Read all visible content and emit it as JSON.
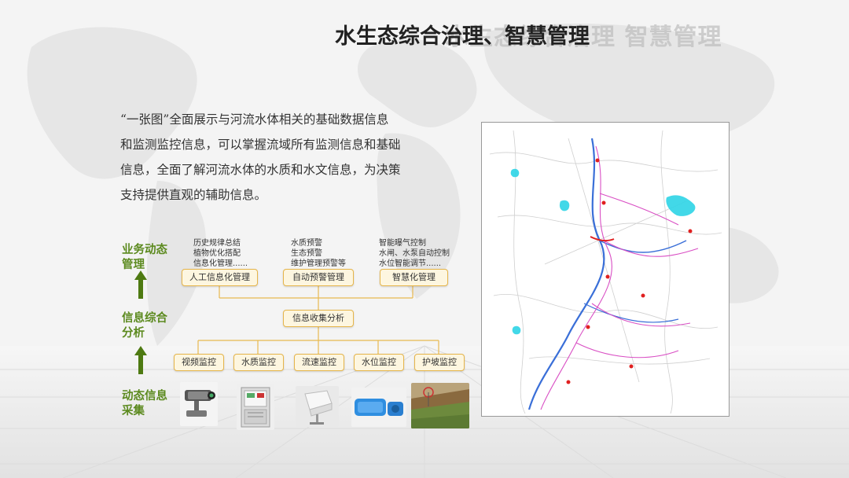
{
  "header": {
    "title": "水生态综合治理、智慧管理",
    "ghost_title": "水生态综合治理 智慧管理"
  },
  "intro": {
    "lines": [
      "“一张图”全面展示与河流水体相关的基础数据信息",
      "和监测监控信息，可以掌握流域所有监测信息和基础",
      "信息，全面了解河流水体的水质和水文信息，为决策",
      "支持提供直观的辅助信息。"
    ]
  },
  "diagram": {
    "levels": [
      {
        "line1": "业务动态",
        "line2": "管理"
      },
      {
        "line1": "信息综合",
        "line2": "分析"
      },
      {
        "line1": "动态信息",
        "line2": "采集"
      }
    ],
    "management_boxes": [
      {
        "label": "人工信息化管理",
        "notes": [
          "历史规律总结",
          "植物优化搭配",
          "信息化管理......"
        ]
      },
      {
        "label": "自动预警管理",
        "notes": [
          "水质预警",
          "生态预警",
          "维护管理预警等"
        ]
      },
      {
        "label": "智慧化管理",
        "notes": [
          "智能曝气控制",
          "水闸、水泵自动控制",
          "水位智能调节......"
        ]
      }
    ],
    "analysis_box": "信息收集分析",
    "monitor_boxes": [
      "视频监控",
      "水质监控",
      "流速监控",
      "水位监控",
      "护坡监控"
    ]
  },
  "icons": {
    "arrow": "up-arrow-icon",
    "devices": [
      "cctv-camera-icon",
      "water-quality-cabinet-icon",
      "flow-sensor-icon",
      "water-level-sensor-icon",
      "slope-photo-icon"
    ]
  },
  "colors": {
    "label_green": "#5c8a1f",
    "box_border": "#e6b54a",
    "box_fill": "#fdf6e0",
    "connector": "#e8b94f"
  }
}
